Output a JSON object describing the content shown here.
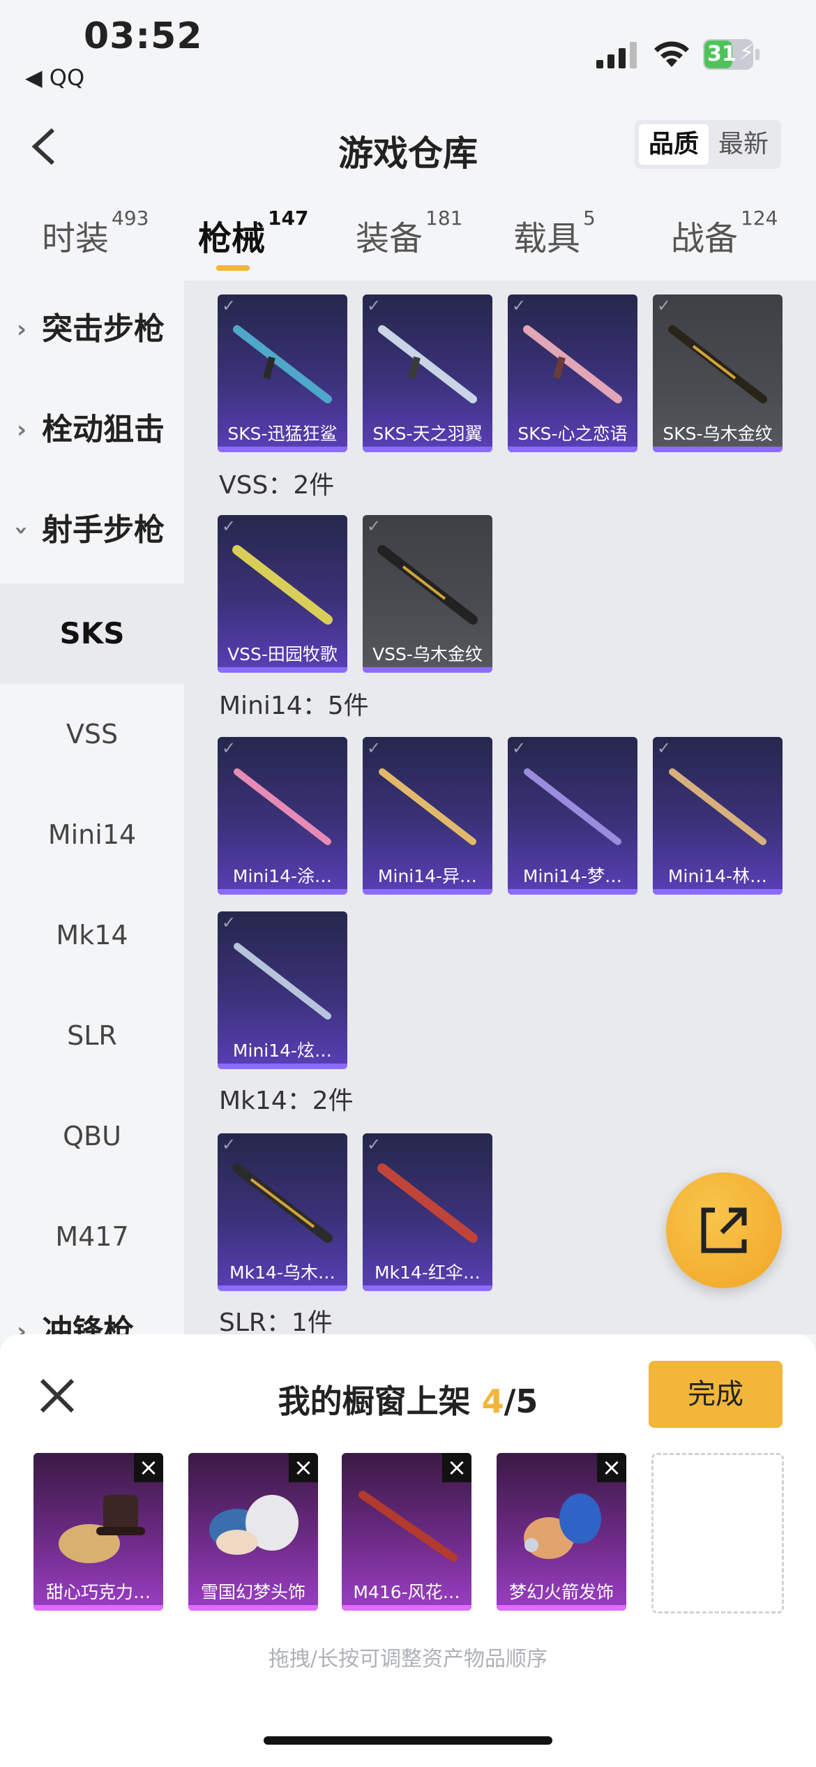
{
  "status": {
    "time": "03:52",
    "back_app": "◀ QQ",
    "battery": "31"
  },
  "header": {
    "title": "游戏仓库",
    "sort_options": [
      "品质",
      "最新"
    ]
  },
  "tabs": [
    {
      "label": "时装",
      "count": "493"
    },
    {
      "label": "枪械",
      "count": "147"
    },
    {
      "label": "装备",
      "count": "181"
    },
    {
      "label": "载具",
      "count": "5"
    },
    {
      "label": "战备",
      "count": "124"
    }
  ],
  "sidebar": {
    "groups": [
      "突击步枪",
      "栓动狙击",
      "射手步枪",
      "冲锋枪"
    ],
    "subs": [
      "SKS",
      "VSS",
      "Mini14",
      "Mk14",
      "SLR",
      "QBU",
      "M417"
    ]
  },
  "sections": [
    {
      "title": "VSS：2件"
    },
    {
      "title": "Mini14：5件"
    },
    {
      "title": "Mk14：2件"
    },
    {
      "title": "SLR：1件"
    }
  ],
  "items": [
    {
      "name": "SKS-迅猛狂鲨"
    },
    {
      "name": "SKS-天之羽翼"
    },
    {
      "name": "SKS-心之恋语"
    },
    {
      "name": "SKS-乌木金纹"
    },
    {
      "name": "VSS-田园牧歌"
    },
    {
      "name": "VSS-乌木金纹"
    },
    {
      "name": "Mini14-涂…"
    },
    {
      "name": "Mini14-异…"
    },
    {
      "name": "Mini14-梦…"
    },
    {
      "name": "Mini14-林…"
    },
    {
      "name": "Mini14-炫…"
    },
    {
      "name": "Mk14-乌木…"
    },
    {
      "name": "Mk14-红伞…"
    }
  ],
  "sheet": {
    "title_prefix": "我的橱窗上架 ",
    "current": "4",
    "total": "/5",
    "done_label": "完成",
    "shelf_items": [
      {
        "name": "甜心巧克力…"
      },
      {
        "name": "雪国幻梦头饰"
      },
      {
        "name": "M416-风花…"
      },
      {
        "name": "梦幻火箭发饰"
      }
    ],
    "hint": "拖拽/长按可调整资产物品顺序"
  }
}
